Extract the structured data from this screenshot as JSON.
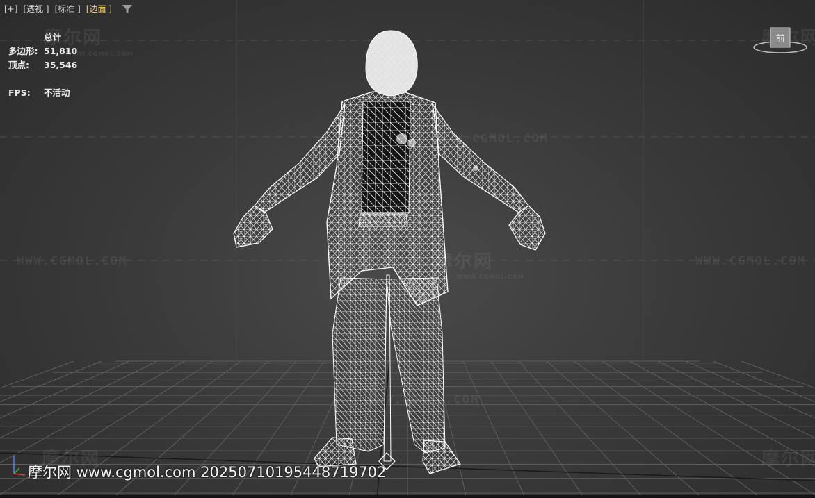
{
  "viewport": {
    "labels": [
      "[+]",
      "[透视 ]",
      "[标准 ]",
      "[边面 ]"
    ],
    "active_label_index": 3,
    "filter_icon": "filter-icon",
    "accent_color": "#f2d46b",
    "background_color": "#3b3b3b"
  },
  "stats": {
    "header": "总计",
    "rows": [
      {
        "key": "多边形:",
        "value": "51,810"
      },
      {
        "key": "顶点:",
        "value": "35,546"
      }
    ],
    "fps_key": "FPS:",
    "fps_value": "不活动"
  },
  "viewcube": {
    "face_label": "前"
  },
  "watermarks": {
    "url": "WWW.CGMOL.COM",
    "brand": "摩尔网",
    "small_url": "WWW.CGMOL.COM"
  },
  "footer": {
    "text": "摩尔网 www.cgmol.com 20250710195448719702"
  }
}
